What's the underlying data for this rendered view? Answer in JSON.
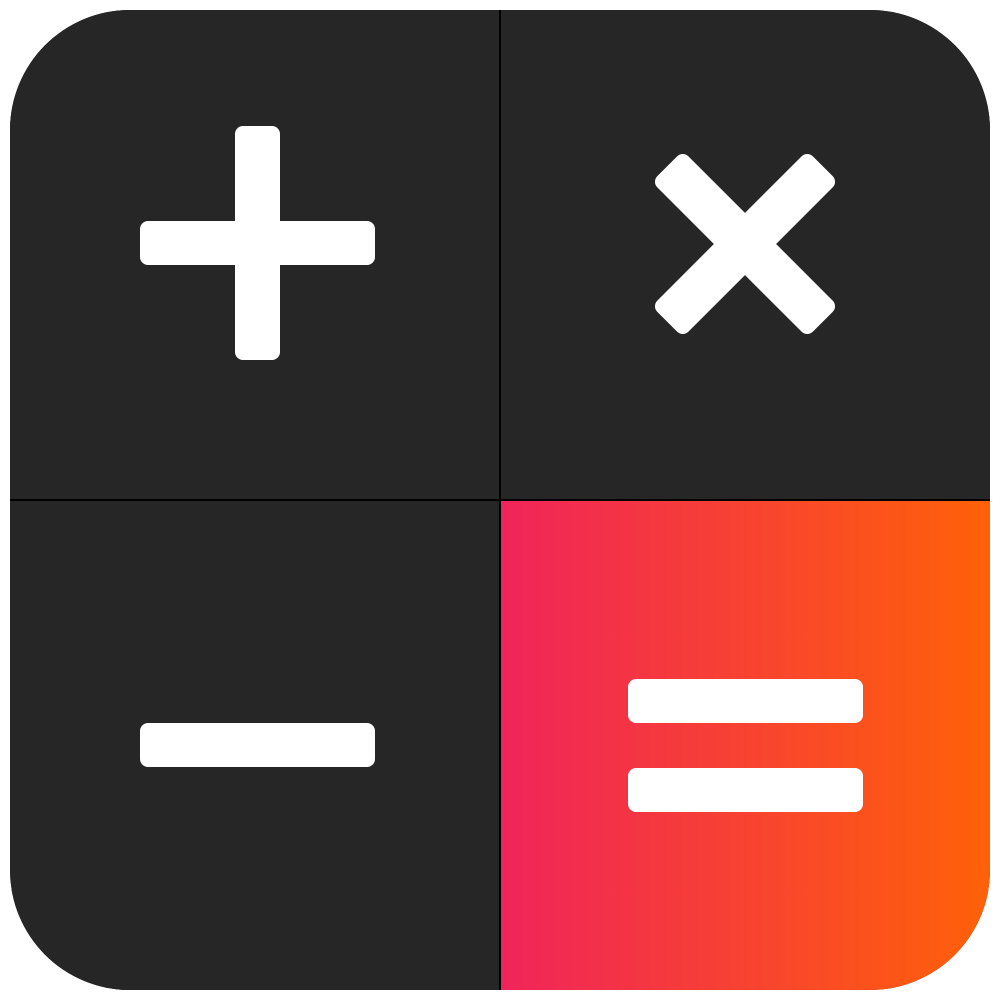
{
  "app_icon": {
    "name": "calculator",
    "keys": [
      {
        "id": "plus",
        "icon": "plus-icon",
        "background": "#262626"
      },
      {
        "id": "multiply",
        "icon": "multiply-icon",
        "background": "#262626"
      },
      {
        "id": "minus",
        "icon": "minus-icon",
        "background": "#262626"
      },
      {
        "id": "equals",
        "icon": "equals-icon",
        "background_gradient": [
          "#F0245A",
          "#FF6108"
        ]
      }
    ],
    "colors": {
      "tile_dark": "#262626",
      "divider": "#000000",
      "glyph": "#FFFFFF",
      "accent_start": "#F0245A",
      "accent_end": "#FF6108"
    }
  }
}
